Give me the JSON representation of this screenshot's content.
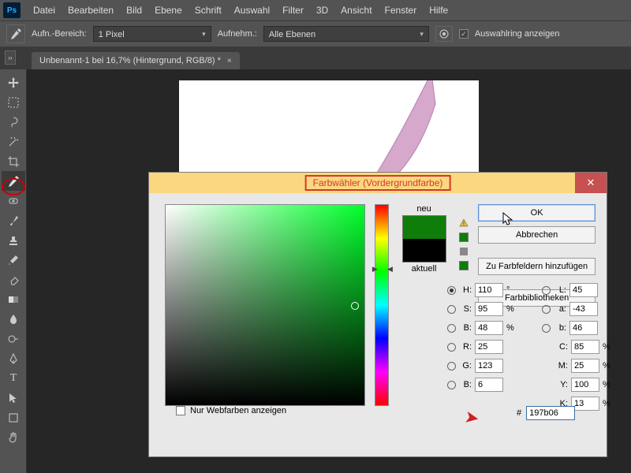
{
  "menu": [
    "Datei",
    "Bearbeiten",
    "Bild",
    "Ebene",
    "Schrift",
    "Auswahl",
    "Filter",
    "3D",
    "Ansicht",
    "Fenster",
    "Hilfe"
  ],
  "options": {
    "range_label": "Aufn.-Bereich:",
    "range_value": "1 Pixel",
    "sample_label": "Aufnehm.:",
    "sample_value": "Alle Ebenen",
    "show_ring": "Auswahlring anzeigen"
  },
  "tab": {
    "title": "Unbenannt-1 bei 16,7% (Hintergrund, RGB/8) *"
  },
  "dialog": {
    "title": "Farbwähler (Vordergrundfarbe)",
    "new_label": "neu",
    "current_label": "aktuell",
    "ok": "OK",
    "cancel": "Abbrechen",
    "add_swatch": "Zu Farbfeldern hinzufügen",
    "libraries": "Farbbibliotheken",
    "web_only": "Nur Webfarben anzeigen",
    "hex": "197b06",
    "H": {
      "l": "H:",
      "v": "110",
      "u": "°"
    },
    "S": {
      "l": "S:",
      "v": "95",
      "u": "%"
    },
    "Bv": {
      "l": "B:",
      "v": "48",
      "u": "%"
    },
    "R": {
      "l": "R:",
      "v": "25",
      "u": ""
    },
    "G": {
      "l": "G:",
      "v": "123",
      "u": ""
    },
    "Bc": {
      "l": "B:",
      "v": "6",
      "u": ""
    },
    "L": {
      "l": "L:",
      "v": "45",
      "u": ""
    },
    "a": {
      "l": "a:",
      "v": "-43",
      "u": ""
    },
    "b": {
      "l": "b:",
      "v": "46",
      "u": ""
    },
    "C": {
      "l": "C:",
      "v": "85",
      "u": "%"
    },
    "M": {
      "l": "M:",
      "v": "25",
      "u": "%"
    },
    "Y": {
      "l": "Y:",
      "v": "100",
      "u": "%"
    },
    "K": {
      "l": "K:",
      "v": "13",
      "u": "%"
    }
  }
}
